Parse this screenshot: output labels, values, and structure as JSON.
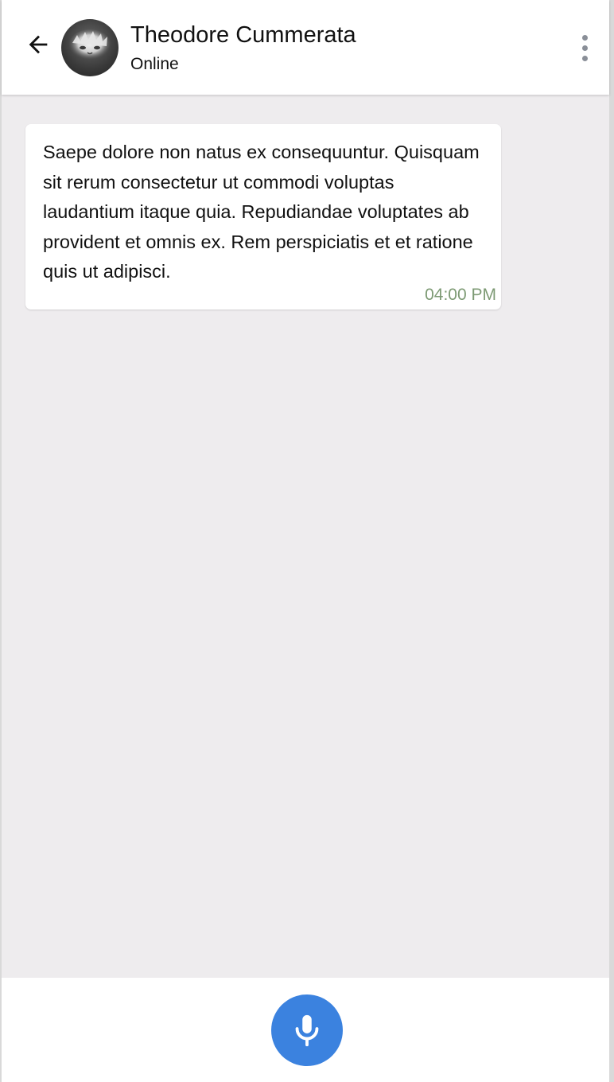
{
  "header": {
    "contact_name": "Theodore Cummerata",
    "status": "Online",
    "back_icon": "arrow-left-icon",
    "more_icon": "more-vertical-icon"
  },
  "messages": [
    {
      "text": "Saepe dolore non natus ex consequuntur. Quisquam sit rerum consectetur ut commodi voluptas laudantium itaque quia. Repudiandae voluptates ab provident et omnis ex. Rem perspiciatis et et ratione quis ut adipisci.",
      "time": "04:00 PM",
      "direction": "incoming"
    }
  ],
  "composer": {
    "mic_icon": "microphone-icon"
  },
  "colors": {
    "accent": "#3b82df",
    "chat_background": "#eeecee",
    "timestamp": "#7d9a74",
    "header_background": "#ffffff"
  }
}
